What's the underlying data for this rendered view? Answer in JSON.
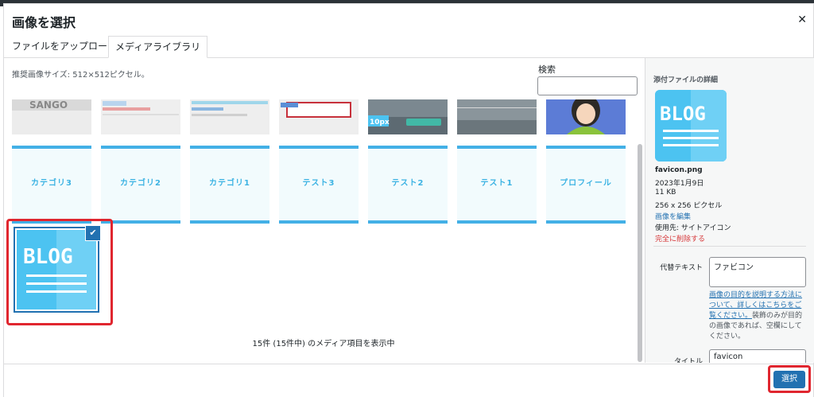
{
  "modal": {
    "title": "画像を選択",
    "close_icon": "close-icon"
  },
  "tabs": [
    {
      "label": "ファイルをアップロード",
      "active": false
    },
    {
      "label": "メディアライブラリ",
      "active": true
    }
  ],
  "toolbar": {
    "recommended_size": "推奨画像サイズ: 512×512ピクセル。",
    "search_label": "検索",
    "search_value": ""
  },
  "grid": {
    "top_row": [
      "SANGO",
      "",
      "",
      "",
      "10px",
      "",
      ""
    ],
    "category_row": [
      "カテゴリ3",
      "カテゴリ2",
      "カテゴリ1",
      "テスト3",
      "テスト2",
      "テスト1",
      "プロフィール"
    ],
    "selected": {
      "text": "BLOG",
      "checked": true
    }
  },
  "status": {
    "count_text": "15件 (15件中) のメディア項目を表示中"
  },
  "sidebar": {
    "heading": "添付ファイルの詳細",
    "thumb_text": "BLOG",
    "filename": "favicon.png",
    "date": "2023年1月9日",
    "filesize": "11 KB",
    "dimensions": "256 x 256 ピクセル",
    "edit_link": "画像を編集",
    "used_in": "使用先: サイトアイコン",
    "delete_link": "完全に削除する",
    "alt_label": "代替テキスト",
    "alt_value": "ファビコン",
    "help_link": "画像の目的を説明する方法について、詳しくはこちらをご覧ください。",
    "help_text": "装飾のみが目的の画像であれば、空欄にしてください。",
    "title_label": "タイトル",
    "title_value": "favicon"
  },
  "footer": {
    "select_label": "選択"
  },
  "colors": {
    "accent": "#2271b1",
    "highlight": "#e0262f",
    "blog_blue": "#4cc3f1",
    "category_text": "#3db3e3"
  }
}
